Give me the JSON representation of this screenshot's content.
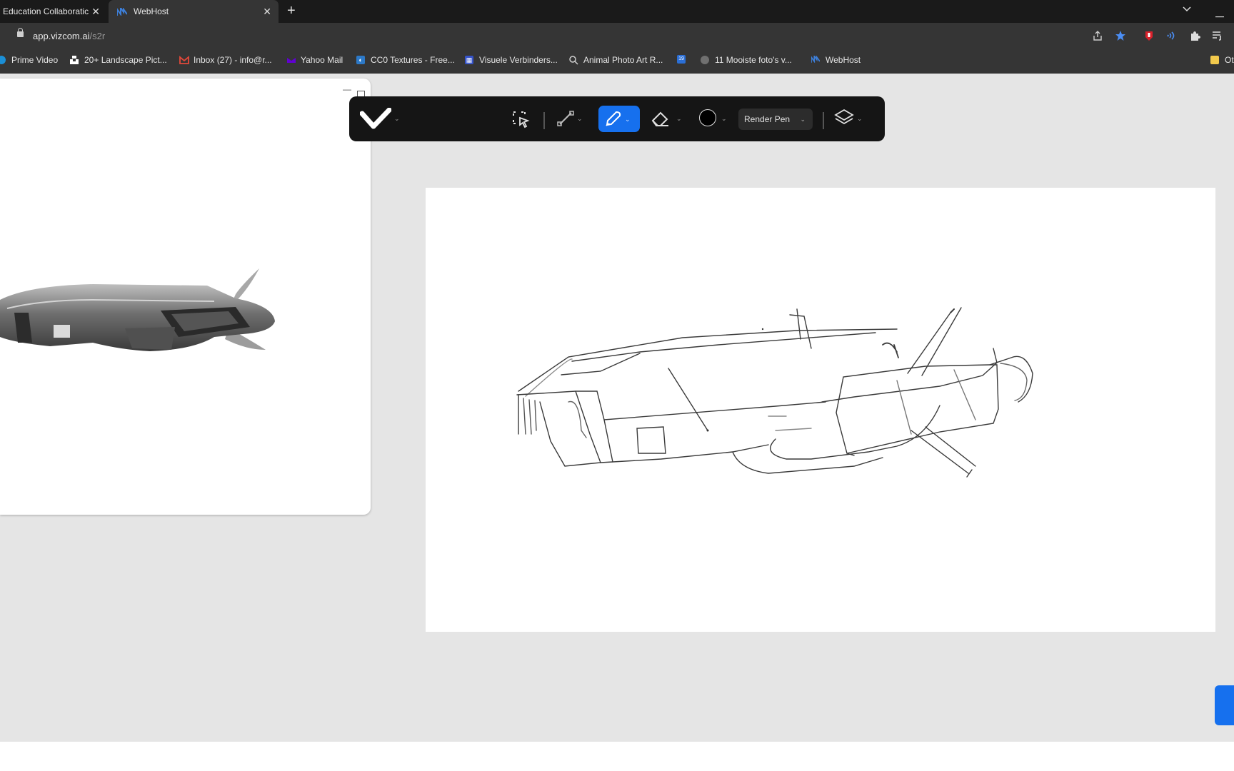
{
  "browser": {
    "tabs": [
      {
        "title": "Education Collaboratic",
        "active": false
      },
      {
        "title": "WebHost",
        "active": true
      }
    ],
    "new_tab_label": "+",
    "address": {
      "host": "app.vizcom.ai",
      "path": "/s2r"
    },
    "bookmarks": [
      {
        "label": "Prime Video",
        "icon": "prime-video-icon"
      },
      {
        "label": "20+ Landscape Pict...",
        "icon": "unsplash-icon"
      },
      {
        "label": "Inbox (27) - info@r...",
        "icon": "gmail-icon"
      },
      {
        "label": "Yahoo Mail",
        "icon": "yahoo-icon"
      },
      {
        "label": "CC0 Textures - Free...",
        "icon": "cc0-icon"
      },
      {
        "label": "Visuele Verbinders...",
        "icon": "visuele-icon"
      },
      {
        "label": "Animal Photo Art R...",
        "icon": "search-icon"
      },
      {
        "label": "",
        "icon": "calendar-icon"
      },
      {
        "label": "11 Mooiste foto's v...",
        "icon": "globe-icon"
      },
      {
        "label": "WebHost",
        "icon": "webhost-icon"
      }
    ],
    "overflow_bookmark": "Ot"
  },
  "toolbar": {
    "logo": "vizcom-logo",
    "tools": [
      "select-tool",
      "line-tool",
      "pen-tool",
      "eraser-tool",
      "color-swatch",
      "layers-tool"
    ],
    "active_tool": "pen-tool",
    "brush_name": "Render Pen",
    "brush_color": "#000000"
  },
  "colors": {
    "accent": "#1670ee",
    "toolbar_bg": "#151515",
    "app_bg": "#e5e5e5",
    "browser_chrome": "#353535",
    "tabstrip": "#1a1a1a"
  },
  "preview_panel": {
    "content": "rendered-spaceship-image"
  },
  "canvas": {
    "content": "spaceship-sketch"
  }
}
